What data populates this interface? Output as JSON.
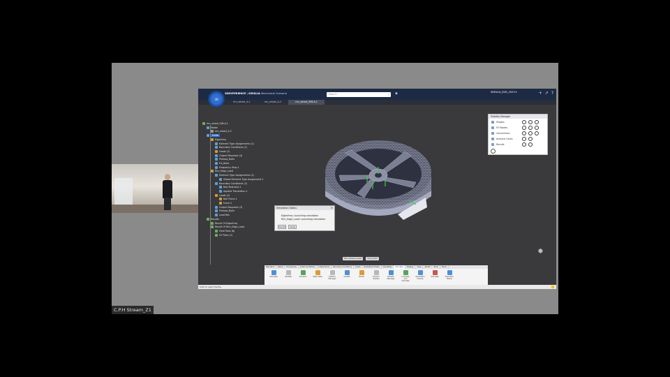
{
  "stream": {
    "label": "C.P.H Stream_Z1"
  },
  "window": {
    "brand_prefix": "3DEXPERIENCE",
    "brand_app": "SIMULIA",
    "brand_role": "Mechanical Scenario",
    "compass_text": "3D",
    "search_placeholder": "Search",
    "user_line": "SIMULIA_R2R_2023 ▾",
    "tabs": [
      "rim_wheel_A.1",
      "rim_wheel_A.2",
      "rim_wheel_SIM-A.1"
    ],
    "active_tab_index": 2
  },
  "tree": [
    {
      "label": "rim_wheel_SIM-A.1",
      "indent": 0,
      "icon": "green"
    },
    {
      "label": "Model",
      "indent": 1,
      "icon": "blue"
    },
    {
      "label": "rim_wheel_A.2",
      "indent": 2,
      "icon": "gray"
    },
    {
      "label": "Finite",
      "indent": 1,
      "icon": "blue",
      "selected": true
    },
    {
      "label": "Eigenfreq",
      "indent": 2,
      "icon": "orange"
    },
    {
      "label": "Element Type Assignments (1)",
      "indent": 3,
      "icon": "blue"
    },
    {
      "label": "Boundary Conditions (1)",
      "indent": 3,
      "icon": "blue"
    },
    {
      "label": "Loads (1)",
      "indent": 3,
      "icon": "orange"
    },
    {
      "label": "Output Requests (4)",
      "indent": 3,
      "icon": "blue"
    },
    {
      "label": "Preload_Bolts",
      "indent": 3,
      "icon": "blue"
    },
    {
      "label": "Fix_Bolts",
      "indent": 3,
      "icon": "blue"
    },
    {
      "label": "Frequency Step.1",
      "indent": 3,
      "icon": "blue"
    },
    {
      "label": "Rim_Edge_Load",
      "indent": 2,
      "icon": "orange"
    },
    {
      "label": "Element Type Assignments (1)",
      "indent": 3,
      "icon": "blue"
    },
    {
      "label": "Global Element Type Assignment.1",
      "indent": 4,
      "icon": "blue"
    },
    {
      "label": "Boundary Conditions (2)",
      "indent": 3,
      "icon": "blue"
    },
    {
      "label": "Bolt Restraint.1",
      "indent": 4,
      "icon": "blue"
    },
    {
      "label": "Applied Translation.1",
      "indent": 4,
      "icon": "blue"
    },
    {
      "label": "Loads (2)",
      "indent": 3,
      "icon": "orange"
    },
    {
      "label": "Bolt Force.1",
      "indent": 4,
      "icon": "orange"
    },
    {
      "label": "Force.1",
      "indent": 4,
      "icon": "orange"
    },
    {
      "label": "Output Requests (3)",
      "indent": 3,
      "icon": "blue"
    },
    {
      "label": "Preload_Bolts",
      "indent": 3,
      "icon": "blue"
    },
    {
      "label": "Load Res",
      "indent": 3,
      "icon": "blue"
    },
    {
      "label": "Results",
      "indent": 1,
      "icon": "green"
    },
    {
      "label": "Result Of Eigenfreq",
      "indent": 2,
      "icon": "green"
    },
    {
      "label": "Result Of Rim_Edge_Load",
      "indent": 2,
      "icon": "green"
    },
    {
      "label": "Field Plots (6)",
      "indent": 3,
      "icon": "green"
    },
    {
      "label": "XY Plots (3)",
      "indent": 3,
      "icon": "green"
    }
  ],
  "visibility_manager": {
    "title": "Visibility Manager",
    "rows": [
      "Shapes",
      "FE Models",
      "Connections",
      "Analysis Cases",
      "Results"
    ]
  },
  "dialog": {
    "title": "Simulation Status",
    "line1": "Eigenfreq: Launching simulation",
    "line2": "Rim_Edge_Load: Launching simulation",
    "btn1": "Cancel",
    "btn2": "Close"
  },
  "view_controls": [
    "Rim wheel_mesh",
    "Solid_Rim"
  ],
  "action_bar": {
    "tabs": [
      "Standard",
      "Setup",
      "Procedures",
      "Initial Conditions",
      "Interactions",
      "Boundary Conditions",
      "Loads",
      "Predefined Fields",
      "Durability",
      "Simulate",
      "Display",
      "View",
      "AR-VR",
      "Tools",
      "Touch"
    ],
    "active_tab": "Simulate",
    "tools": [
      "Simulate",
      "Validate",
      "Scenario",
      "Mesh Data",
      "Feature Manager",
      "Update",
      "Model",
      "Physics Results",
      "Results Manager",
      "Compute and Simulate",
      "Simulation Checks",
      "Simulate",
      "Execution Status"
    ]
  },
  "statusbar": {
    "text": "Click to open the file"
  },
  "colors": {
    "app_header": "#1d2a44",
    "selection": "#2f76d6",
    "accent": "#4e8fd8"
  }
}
